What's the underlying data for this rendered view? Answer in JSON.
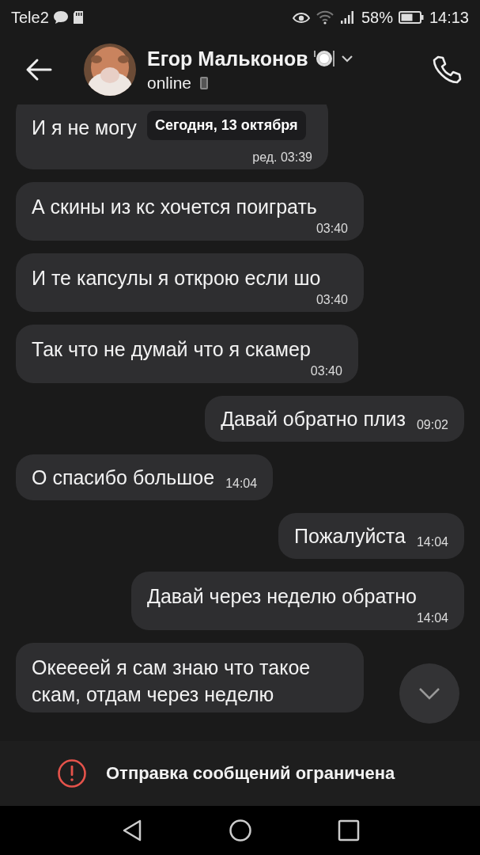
{
  "status_bar": {
    "carrier": "Tele2",
    "battery": "58%",
    "time": "14:13"
  },
  "header": {
    "name": "Егор Мальконов",
    "status": "online"
  },
  "date_pill": "Сегодня, 13 октября",
  "messages": [
    {
      "outgoing": false,
      "text": "И я не могу",
      "time": "ред. 03:39",
      "time_below": true
    },
    {
      "outgoing": false,
      "text": "А скины из кс хочется поиграть",
      "time": "03:40",
      "time_below": true
    },
    {
      "outgoing": false,
      "text": "И те капсулы я открою если шо",
      "time": "03:40",
      "time_below": true
    },
    {
      "outgoing": false,
      "text": "Так что не думай что я скамер",
      "time": "03:40",
      "time_below": true
    },
    {
      "outgoing": true,
      "text": "Давай обратно плиз",
      "time": "09:02",
      "time_below": false
    },
    {
      "outgoing": false,
      "text": "О спасибо большое",
      "time": "14:04",
      "time_below": false
    },
    {
      "outgoing": true,
      "text": "Пожалуйста",
      "time": "14:04",
      "time_below": false
    },
    {
      "outgoing": true,
      "text": "Давай через неделю обратно",
      "time": "14:04",
      "time_below": true
    },
    {
      "outgoing": false,
      "text": "Океееей я сам знаю что такое скам, отдам через неделю"
    }
  ],
  "notice": "Отправка сообщений ограничена"
}
